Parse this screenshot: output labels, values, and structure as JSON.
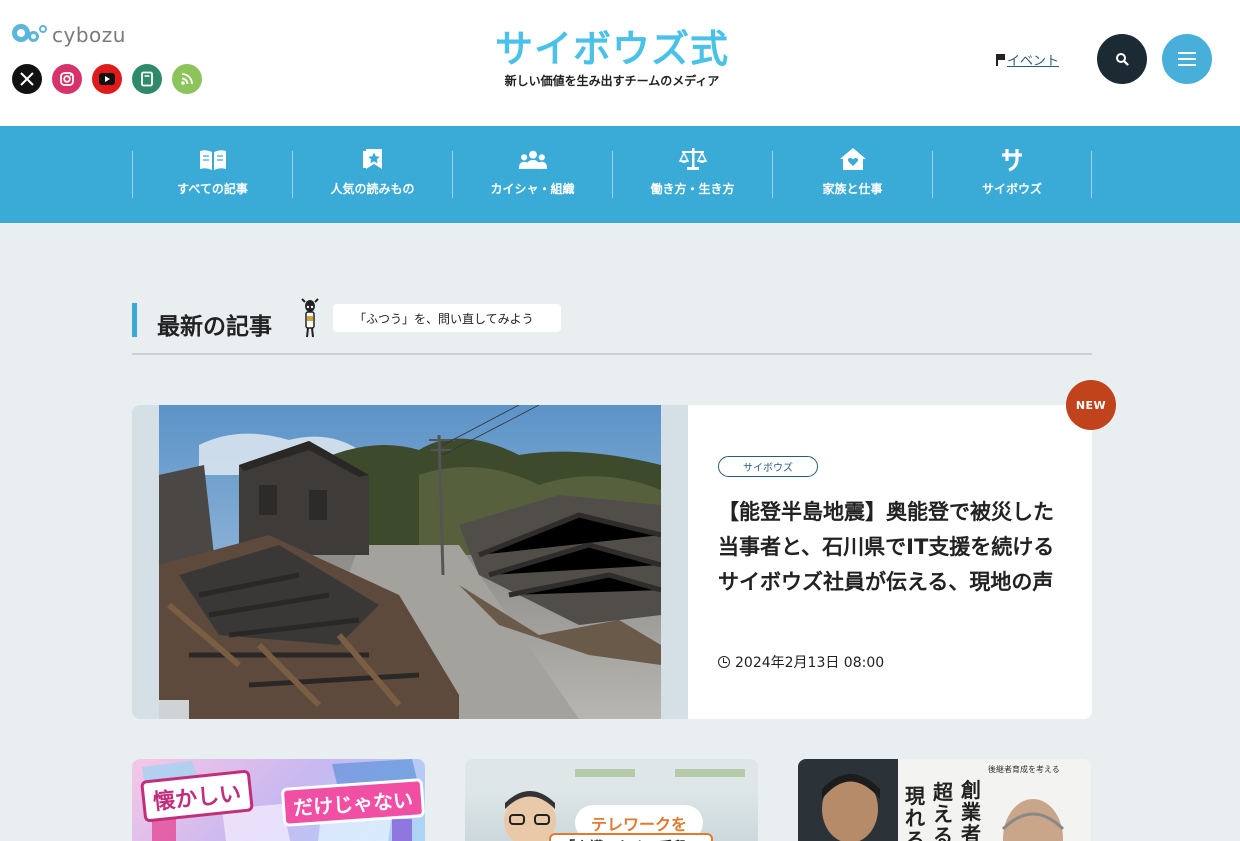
{
  "header": {
    "cybozu_logo_text": "cybozu",
    "brand_name": "サイボウズ式",
    "tagline": "新しい価値を生み出すチームのメディア",
    "event_link": "イベント",
    "social": [
      "x-icon",
      "instagram-icon",
      "youtube-icon",
      "note-icon",
      "rss-icon"
    ]
  },
  "nav": {
    "items": [
      {
        "label": "すべての記事",
        "icon": "book-icon"
      },
      {
        "label": "人気の読みもの",
        "icon": "bookmark-star-icon"
      },
      {
        "label": "カイシャ・組織",
        "icon": "group-icon"
      },
      {
        "label": "働き方・生き方",
        "icon": "balance-icon"
      },
      {
        "label": "家族と仕事",
        "icon": "home-heart-icon"
      },
      {
        "label": "サイボウズ",
        "icon": "sa-icon"
      }
    ]
  },
  "latest": {
    "title": "最新の記事",
    "bubble": "「ふつう」を、問い直してみよう"
  },
  "hero": {
    "badge": "NEW",
    "category": "サイボウズ",
    "title": "【能登半島地震】奥能登で被災した当事者と、石川県でIT支援を続けるサイボウズ社員が伝える、現地の声",
    "date": "2024年2月13日 08:00"
  },
  "cards": [
    {
      "text": "懐かしい",
      "text2": "だけじゃない"
    },
    {
      "text": "テレワークを",
      "text2": "「介護のための手段」"
    },
    {
      "text": "創業者",
      "text2": "超える",
      "text3": "現れる",
      "small": "後継者育成を考える"
    }
  ],
  "colors": {
    "brand": "#49c1e8",
    "nav": "#3aaad7",
    "new_badge": "#c0431c",
    "background": "#e9eef1"
  }
}
